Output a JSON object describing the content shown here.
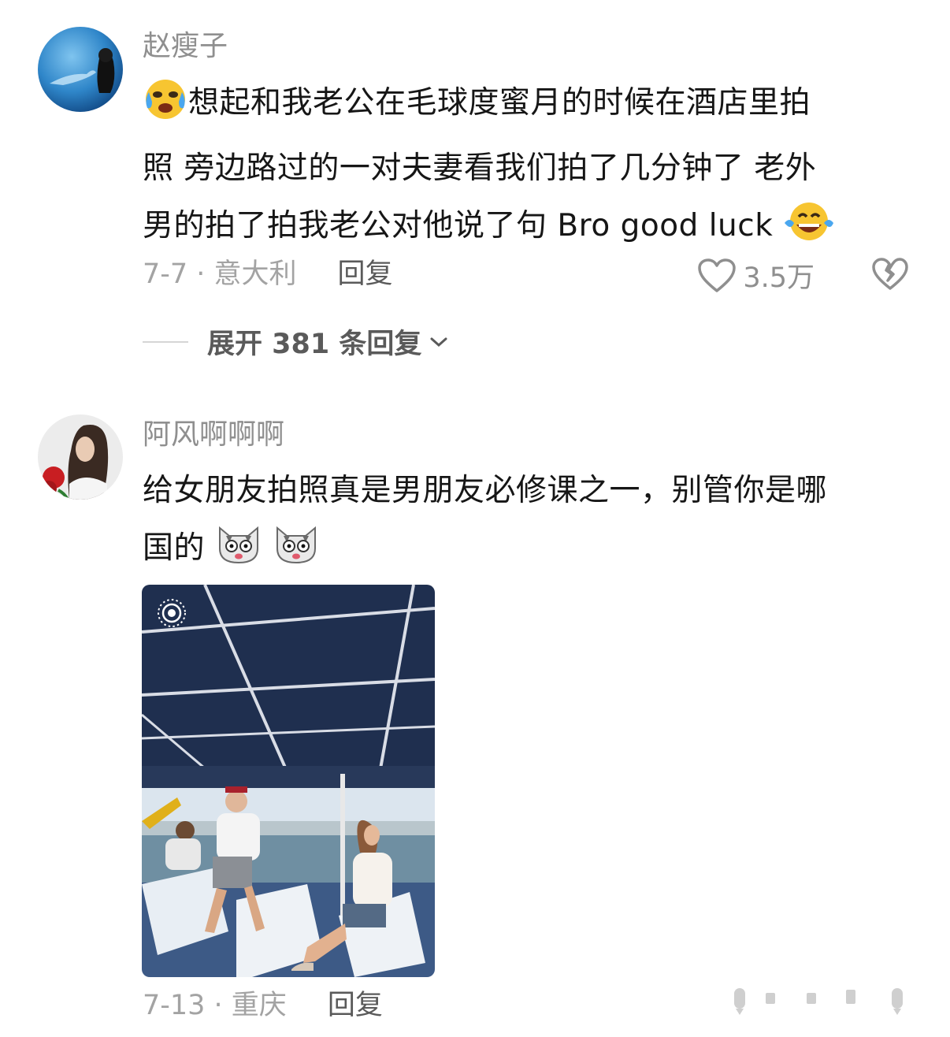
{
  "comments": [
    {
      "username": "赵瘦子",
      "lines": [
        "想起和我老公在毛球度蜜月的时候在酒店里拍",
        "照 旁边路过的一对夫妻看我们拍了几分钟了 老外",
        "男的拍了拍我老公对他说了句 Bro good luck"
      ],
      "emojis": [
        "cry-laugh-emoji",
        "tears-of-joy-emoji"
      ],
      "date_location": "7-7 · 意大利",
      "reply_label": "回复",
      "likes": "3.5万",
      "expand_label": "展开 381 条回复"
    },
    {
      "username": "阿风啊啊啊",
      "lines": [
        "给女朋友拍照真是男朋友必修课之一，别管你是哪",
        "国的"
      ],
      "emojis": [
        "shocked-cat-emoji",
        "shocked-cat-emoji"
      ],
      "date_location": "7-13 · 重庆",
      "reply_label": "回复",
      "photo_alt": "boat-deck-photo"
    }
  ],
  "colors": {
    "username": "#8f8f8f",
    "text": "#161616",
    "meta": "#a3a3a3",
    "reply": "#5a5a5a",
    "canopy": "#1f2f4f"
  }
}
